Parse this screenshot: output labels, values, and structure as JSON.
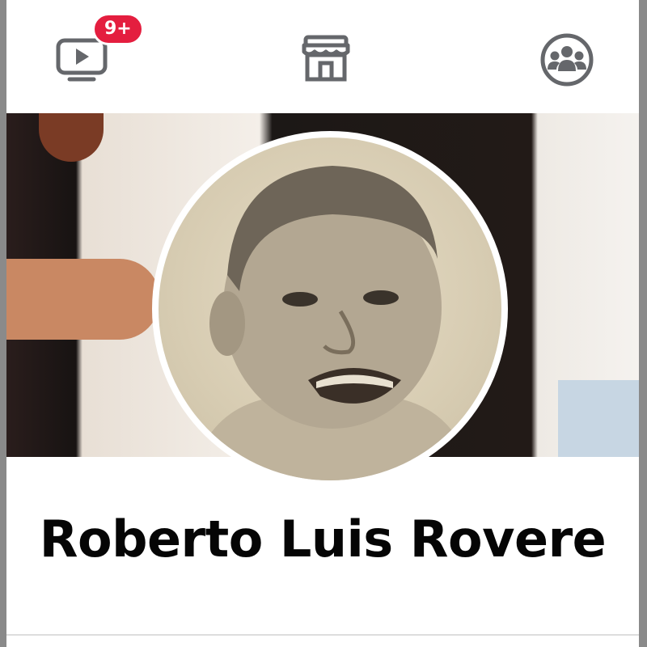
{
  "nav": {
    "items": [
      {
        "name": "watch",
        "icon": "video-play-icon"
      },
      {
        "name": "marketplace",
        "icon": "storefront-icon"
      },
      {
        "name": "groups",
        "icon": "groups-icon"
      }
    ],
    "watch_badge": "9+"
  },
  "profile": {
    "name": "Roberto Luis Rovere"
  },
  "colors": {
    "badge": "#e41e3f",
    "icon": "#65676b",
    "text": "#050505"
  }
}
